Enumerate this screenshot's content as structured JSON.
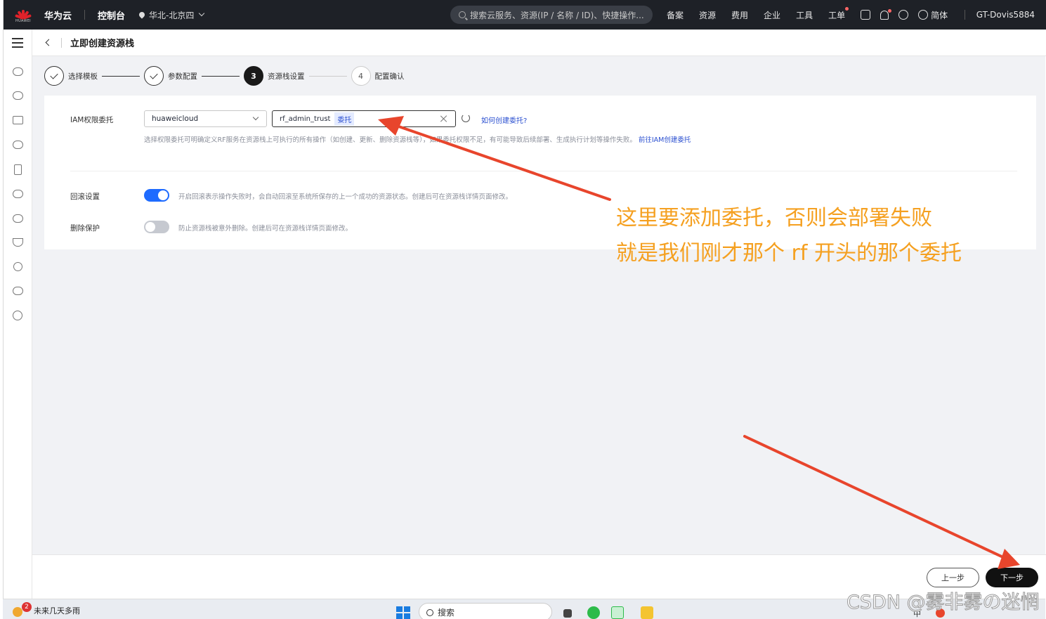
{
  "topbar": {
    "brand": "华为云",
    "logo_text": "HUAWEI",
    "console": "控制台",
    "region": "华北-北京四",
    "search_placeholder": "搜索云服务、资源(IP / 名称 / ID)、快捷操作...",
    "nav": [
      "备案",
      "资源",
      "费用",
      "企业",
      "工具",
      "工单"
    ],
    "lang": "简体",
    "username": "GT-Dovis5884"
  },
  "page": {
    "title": "立即创建资源栈"
  },
  "steps": [
    {
      "number": "1",
      "label": "选择模板",
      "state": "done"
    },
    {
      "number": "2",
      "label": "参数配置",
      "state": "done"
    },
    {
      "number": "3",
      "label": "资源栈设置",
      "state": "active"
    },
    {
      "number": "4",
      "label": "配置确认",
      "state": "todo"
    }
  ],
  "form": {
    "iam_label": "IAM权限委托",
    "provider_value": "huaweicloud",
    "agency_value": "rf_admin_trust",
    "agency_tag": "委托",
    "howto_link": "如何创建委托?",
    "hint_text": "选择权限委托可明确定义RF服务在资源栈上可执行的所有操作（如创建、更新、删除资源栈等），如果委托权限不足，有可能导致后续部署、生成执行计划等操作失败。",
    "hint_link": "前往IAM创建委托",
    "rollback_label": "回滚设置",
    "rollback_on": true,
    "rollback_desc": "开启回滚表示操作失败时，会自动回滚至系统所保存的上一个成功的资源状态。创建后可在资源栈详情页面修改。",
    "delete_label": "删除保护",
    "delete_on": false,
    "delete_desc": "防止资源栈被意外删除。创建后可在资源栈详情页面修改。"
  },
  "footer": {
    "prev": "上一步",
    "next": "下一步"
  },
  "annotation": {
    "line1": "这里要添加委托，否则会部署失败",
    "line2": "就是我们刚才那个 rf 开头的那个委托",
    "color": "#f5a020",
    "arrow_color": "#e8452c"
  },
  "taskbar": {
    "weather": "未来几天多雨",
    "badge": "2",
    "search": "搜索",
    "ime": "中"
  },
  "watermark": "CSDN @雾非雾の迷惘"
}
